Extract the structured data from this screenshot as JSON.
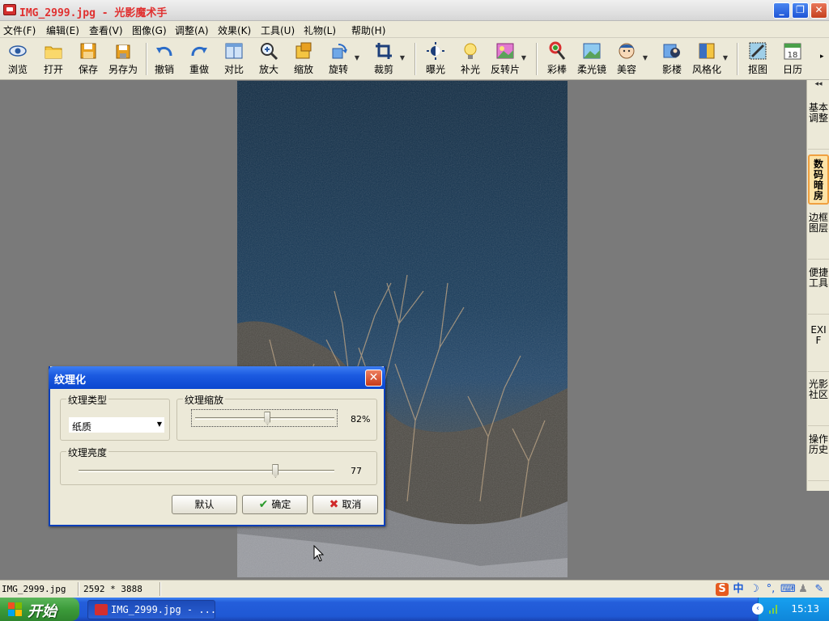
{
  "window": {
    "title": "IMG_2999.jpg - 光影魔术手"
  },
  "menu": [
    "文件(F)",
    "编辑(E)",
    "查看(V)",
    "图像(G)",
    "调整(A)",
    "效果(K)",
    "工具(U)",
    "礼物(L)",
    "帮助(H)"
  ],
  "toolbar": [
    {
      "label": "浏览",
      "icon": "eye-icon"
    },
    {
      "label": "打开",
      "icon": "folder-open-icon"
    },
    {
      "label": "保存",
      "icon": "save-icon"
    },
    {
      "label": "另存为",
      "icon": "save-as-icon"
    },
    {
      "label": "撤销",
      "icon": "undo-icon"
    },
    {
      "label": "重做",
      "icon": "redo-icon"
    },
    {
      "label": "对比",
      "icon": "compare-icon"
    },
    {
      "label": "放大",
      "icon": "zoom-in-icon"
    },
    {
      "label": "缩放",
      "icon": "resize-icon"
    },
    {
      "label": "旋转",
      "icon": "rotate-icon"
    },
    {
      "label": "裁剪",
      "icon": "crop-icon"
    },
    {
      "label": "曝光",
      "icon": "exposure-icon"
    },
    {
      "label": "补光",
      "icon": "fill-light-icon"
    },
    {
      "label": "反转片",
      "icon": "reversal-film-icon"
    },
    {
      "label": "彩棒",
      "icon": "color-wand-icon"
    },
    {
      "label": "柔光镜",
      "icon": "soft-focus-icon"
    },
    {
      "label": "美容",
      "icon": "beauty-icon"
    },
    {
      "label": "影楼",
      "icon": "studio-icon"
    },
    {
      "label": "风格化",
      "icon": "stylize-icon"
    },
    {
      "label": "抠图",
      "icon": "cutout-icon"
    },
    {
      "label": "日历",
      "icon": "calendar-icon",
      "day": "18"
    }
  ],
  "side_tabs": [
    {
      "label": "基本调整",
      "active": false
    },
    {
      "label": "数码暗房",
      "active": true
    },
    {
      "label": "边框图层",
      "active": false
    },
    {
      "label": "便捷工具",
      "active": false
    },
    {
      "label": "EXIF",
      "active": false
    },
    {
      "label": "光影社区",
      "active": false
    },
    {
      "label": "操作历史",
      "active": false
    }
  ],
  "dialog": {
    "title": "纹理化",
    "texture_type": {
      "label": "纹理类型",
      "value": "纸质"
    },
    "texture_scale": {
      "label": "纹理缩放",
      "value": "82%",
      "level": 0.52
    },
    "texture_brightness": {
      "label": "纹理亮度",
      "value": "77",
      "level": 0.77
    },
    "buttons": {
      "default": "默认",
      "ok": "确定",
      "cancel": "取消"
    }
  },
  "status": {
    "filename": "IMG_2999.jpg",
    "dimensions": "2592 * 3888"
  },
  "taskbar": {
    "start": "开始",
    "task": "IMG_2999.jpg - ...",
    "clock": "15:13"
  },
  "colors": {
    "titlebar_text": "#e03030",
    "xp_blue": "#245edb",
    "start_green": "#3c9b3a",
    "active_tab": "#fde3a7"
  }
}
